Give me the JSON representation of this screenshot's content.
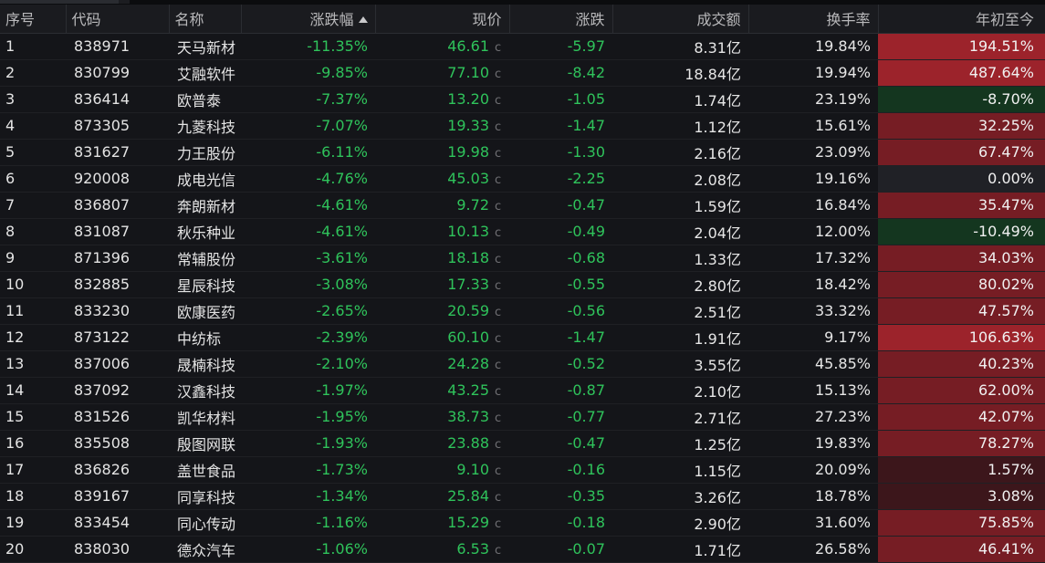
{
  "columns": {
    "index": "序号",
    "code": "代码",
    "name": "名称",
    "pct_change": "涨跌幅",
    "price": "现价",
    "change": "涨跌",
    "volume": "成交额",
    "turnover": "换手率",
    "ytd": "年初至今"
  },
  "sort": {
    "column": "pct_change",
    "direction": "ascending"
  },
  "price_marker": "c",
  "colors": {
    "down_text": "#2fc35b",
    "ytd_positive_strong": "#9c232b",
    "ytd_positive_mid": "#761d24",
    "ytd_positive_weak": "#3c161b",
    "ytd_neutral": "#202126",
    "ytd_negative": "#14361f"
  },
  "rows": [
    {
      "index": "1",
      "code": "838971",
      "name": "天马新材",
      "pct_change": "-11.35%",
      "price": "46.61",
      "change": "-5.97",
      "volume": "8.31亿",
      "turnover": "19.84%",
      "ytd": "194.51%",
      "ytd_value": 194.51
    },
    {
      "index": "2",
      "code": "830799",
      "name": "艾融软件",
      "pct_change": "-9.85%",
      "price": "77.10",
      "change": "-8.42",
      "volume": "18.84亿",
      "turnover": "19.94%",
      "ytd": "487.64%",
      "ytd_value": 487.64
    },
    {
      "index": "3",
      "code": "836414",
      "name": "欧普泰",
      "pct_change": "-7.37%",
      "price": "13.20",
      "change": "-1.05",
      "volume": "1.74亿",
      "turnover": "23.19%",
      "ytd": "-8.70%",
      "ytd_value": -8.7
    },
    {
      "index": "4",
      "code": "873305",
      "name": "九菱科技",
      "pct_change": "-7.07%",
      "price": "19.33",
      "change": "-1.47",
      "volume": "1.12亿",
      "turnover": "15.61%",
      "ytd": "32.25%",
      "ytd_value": 32.25
    },
    {
      "index": "5",
      "code": "831627",
      "name": "力王股份",
      "pct_change": "-6.11%",
      "price": "19.98",
      "change": "-1.30",
      "volume": "2.16亿",
      "turnover": "23.09%",
      "ytd": "67.47%",
      "ytd_value": 67.47
    },
    {
      "index": "6",
      "code": "920008",
      "name": "成电光信",
      "pct_change": "-4.76%",
      "price": "45.03",
      "change": "-2.25",
      "volume": "2.08亿",
      "turnover": "19.16%",
      "ytd": "0.00%",
      "ytd_value": 0.0
    },
    {
      "index": "7",
      "code": "836807",
      "name": "奔朗新材",
      "pct_change": "-4.61%",
      "price": "9.72",
      "change": "-0.47",
      "volume": "1.59亿",
      "turnover": "16.84%",
      "ytd": "35.47%",
      "ytd_value": 35.47
    },
    {
      "index": "8",
      "code": "831087",
      "name": "秋乐种业",
      "pct_change": "-4.61%",
      "price": "10.13",
      "change": "-0.49",
      "volume": "2.04亿",
      "turnover": "12.00%",
      "ytd": "-10.49%",
      "ytd_value": -10.49
    },
    {
      "index": "9",
      "code": "871396",
      "name": "常辅股份",
      "pct_change": "-3.61%",
      "price": "18.18",
      "change": "-0.68",
      "volume": "1.33亿",
      "turnover": "17.32%",
      "ytd": "34.03%",
      "ytd_value": 34.03
    },
    {
      "index": "10",
      "code": "832885",
      "name": "星辰科技",
      "pct_change": "-3.08%",
      "price": "17.33",
      "change": "-0.55",
      "volume": "2.80亿",
      "turnover": "18.42%",
      "ytd": "80.02%",
      "ytd_value": 80.02
    },
    {
      "index": "11",
      "code": "833230",
      "name": "欧康医药",
      "pct_change": "-2.65%",
      "price": "20.59",
      "change": "-0.56",
      "volume": "2.51亿",
      "turnover": "33.32%",
      "ytd": "47.57%",
      "ytd_value": 47.57
    },
    {
      "index": "12",
      "code": "873122",
      "name": "中纺标",
      "pct_change": "-2.39%",
      "price": "60.10",
      "change": "-1.47",
      "volume": "1.91亿",
      "turnover": "9.17%",
      "ytd": "106.63%",
      "ytd_value": 106.63
    },
    {
      "index": "13",
      "code": "837006",
      "name": "晟楠科技",
      "pct_change": "-2.10%",
      "price": "24.28",
      "change": "-0.52",
      "volume": "3.55亿",
      "turnover": "45.85%",
      "ytd": "40.23%",
      "ytd_value": 40.23
    },
    {
      "index": "14",
      "code": "837092",
      "name": "汉鑫科技",
      "pct_change": "-1.97%",
      "price": "43.25",
      "change": "-0.87",
      "volume": "2.10亿",
      "turnover": "15.13%",
      "ytd": "62.00%",
      "ytd_value": 62.0
    },
    {
      "index": "15",
      "code": "831526",
      "name": "凯华材料",
      "pct_change": "-1.95%",
      "price": "38.73",
      "change": "-0.77",
      "volume": "2.71亿",
      "turnover": "27.23%",
      "ytd": "42.07%",
      "ytd_value": 42.07
    },
    {
      "index": "16",
      "code": "835508",
      "name": "殷图网联",
      "pct_change": "-1.93%",
      "price": "23.88",
      "change": "-0.47",
      "volume": "1.25亿",
      "turnover": "19.83%",
      "ytd": "78.27%",
      "ytd_value": 78.27
    },
    {
      "index": "17",
      "code": "836826",
      "name": "盖世食品",
      "pct_change": "-1.73%",
      "price": "9.10",
      "change": "-0.16",
      "volume": "1.15亿",
      "turnover": "20.09%",
      "ytd": "1.57%",
      "ytd_value": 1.57
    },
    {
      "index": "18",
      "code": "839167",
      "name": "同享科技",
      "pct_change": "-1.34%",
      "price": "25.84",
      "change": "-0.35",
      "volume": "3.26亿",
      "turnover": "18.78%",
      "ytd": "3.08%",
      "ytd_value": 3.08
    },
    {
      "index": "19",
      "code": "833454",
      "name": "同心传动",
      "pct_change": "-1.16%",
      "price": "15.29",
      "change": "-0.18",
      "volume": "2.90亿",
      "turnover": "31.60%",
      "ytd": "75.85%",
      "ytd_value": 75.85
    },
    {
      "index": "20",
      "code": "838030",
      "name": "德众汽车",
      "pct_change": "-1.06%",
      "price": "6.53",
      "change": "-0.07",
      "volume": "1.71亿",
      "turnover": "26.58%",
      "ytd": "46.41%",
      "ytd_value": 46.41
    }
  ]
}
